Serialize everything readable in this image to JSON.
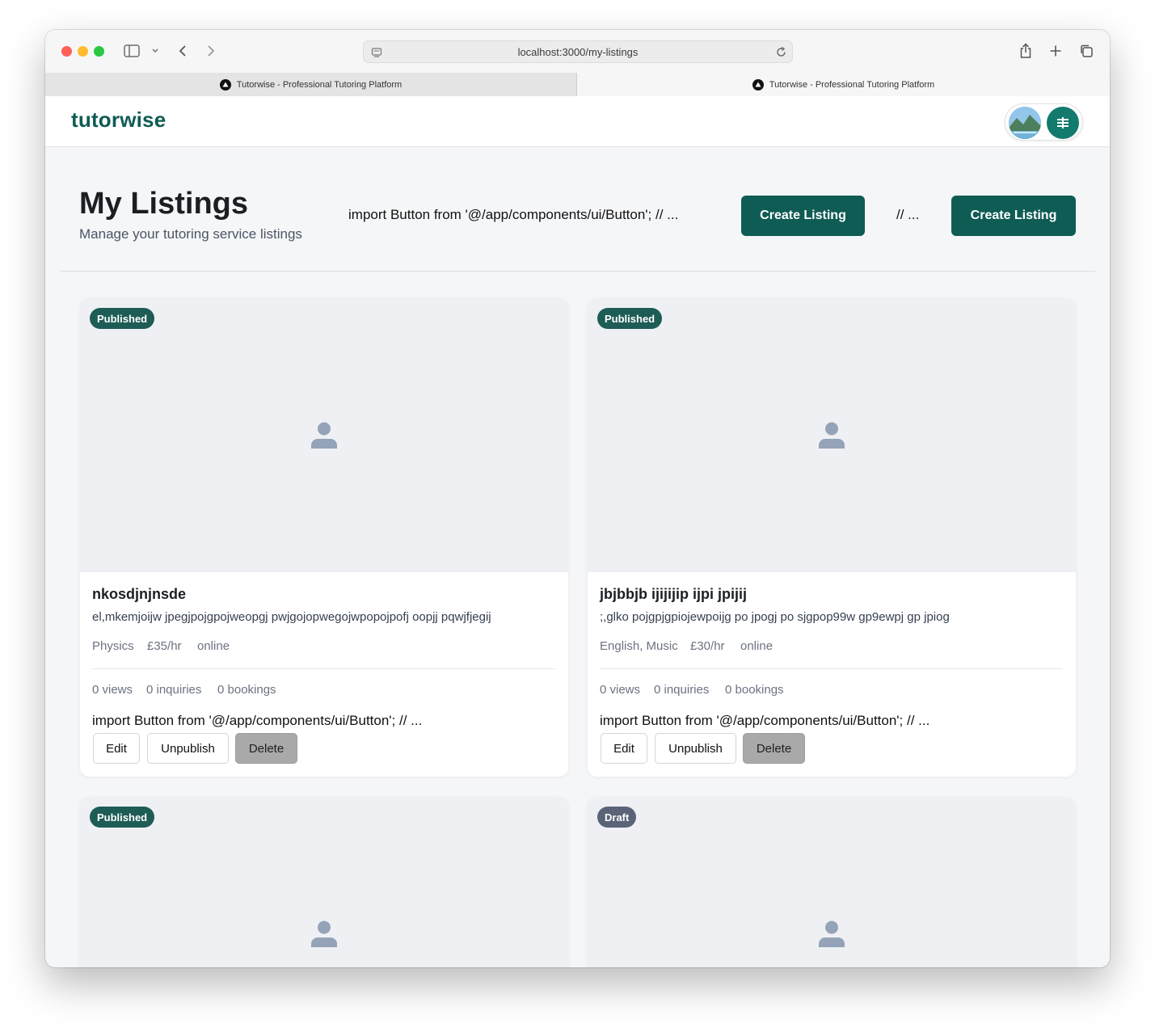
{
  "browser": {
    "url": "localhost:3000/my-listings",
    "tabs": [
      {
        "title": "Tutorwise - Professional Tutoring Platform"
      },
      {
        "title": "Tutorwise - Professional Tutoring Platform"
      }
    ]
  },
  "header": {
    "logo": "tutorwise"
  },
  "page": {
    "title": "My Listings",
    "subtitle": "Manage your tutoring service listings",
    "import_text": "import Button from '@/app/components/ui/Button'; // ...",
    "create_label_1": "Create Listing",
    "comment_text": "// ...",
    "create_label_2": "Create Listing"
  },
  "colors": {
    "brand": "#0f5c54",
    "published_badge": "#1e5c56",
    "draft_badge": "#5a6378"
  },
  "listings": [
    {
      "status": "Published",
      "title": "nkosdjnjnsde",
      "description": "el,mkemjoijw jpegjpojgpojweopgj pwjgojopwegojwpopojpofj oopjj pqwjfjegij",
      "subject": "Physics",
      "price": "£35/hr",
      "mode": "online",
      "views": "0 views",
      "inquiries": "0 inquiries",
      "bookings": "0 bookings",
      "code": "import Button from '@/app/components/ui/Button'; // ...",
      "edit": "Edit",
      "unpublish": "Unpublish",
      "delete": "Delete"
    },
    {
      "status": "Published",
      "title": "jbjbbjb ijijijip ijpi jpijij",
      "description": ";,glko pojgpjgpiojewpoijg po jpogj po sjgpop99w gp9ewpj gp jpiog",
      "subject": "English, Music",
      "price": "£30/hr",
      "mode": "online",
      "views": "0 views",
      "inquiries": "0 inquiries",
      "bookings": "0 bookings",
      "code": "import Button from '@/app/components/ui/Button'; // ...",
      "edit": "Edit",
      "unpublish": "Unpublish",
      "delete": "Delete"
    },
    {
      "status": "Published"
    },
    {
      "status": "Draft"
    }
  ]
}
